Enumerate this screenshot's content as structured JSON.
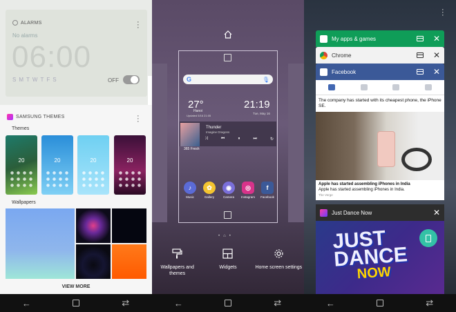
{
  "panel1": {
    "alarm": {
      "title": "ALARMS",
      "status": "No alarms",
      "time": "06:00",
      "days": "SMTWTFS",
      "toggle_label": "OFF"
    },
    "themes": {
      "title": "SAMSUNG THEMES",
      "themes_label": "Themes",
      "theme_times": [
        "20",
        "20",
        "20",
        "20"
      ],
      "wallpapers_label": "Wallpapers",
      "view_more": "VIEW MORE"
    }
  },
  "panel2": {
    "weather": {
      "temp": "27°",
      "city": "Hanoi",
      "updated": "Updated 5/16 21:05"
    },
    "clock": {
      "time": "21:19",
      "date": "Tue, May 16"
    },
    "music": {
      "title": "Thunder",
      "artist": "Imagine Dragons",
      "sub": "365 Fresh"
    },
    "apps": [
      {
        "label": "Music",
        "color": "#5b6bd6",
        "glyph": "♪"
      },
      {
        "label": "Gallery",
        "color": "#f4c430",
        "glyph": "✿"
      },
      {
        "label": "Camera",
        "color": "#7a6fd9",
        "glyph": "◉"
      },
      {
        "label": "Instagram",
        "color": "#d8338a",
        "glyph": "◎"
      },
      {
        "label": "Facebook",
        "color": "#3b5998",
        "glyph": "f"
      }
    ],
    "options": {
      "wallpapers": "Wallpapers and themes",
      "widgets": "Widgets",
      "home_settings": "Home screen settings"
    }
  },
  "panel3": {
    "cards": {
      "myapps": {
        "title": "My apps & games",
        "color": "#0f9d58"
      },
      "chrome": {
        "title": "Chrome",
        "color": "#f2f2f2"
      },
      "facebook": {
        "title": "Facebook",
        "color": "#3b5998"
      },
      "justdance": {
        "title": "Just Dance Now",
        "color": "#2d2d2d"
      }
    },
    "fb_post_text": "The company has started with its cheapest phone, the iPhone SE.",
    "fb_caption_title": "Apple has started assembling iPhones in India",
    "fb_caption_desc": "Apple has started assembling iPhones in India.",
    "fb_source": "The Verge",
    "jd_logo_line1": "JUST",
    "jd_logo_line2": "DANCE",
    "jd_logo_line3": "NOW"
  },
  "nav": {
    "back": "←",
    "recents": "⇄"
  }
}
